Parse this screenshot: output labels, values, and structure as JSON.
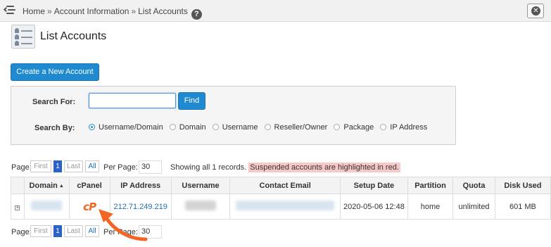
{
  "breadcrumb": {
    "home": "Home",
    "section": "Account Information",
    "current": "List Accounts",
    "separator": "»"
  },
  "page": {
    "title": "List Accounts"
  },
  "actions": {
    "create_label": "Create a New Account"
  },
  "search": {
    "search_for_label": "Search For:",
    "input_value": "",
    "find_label": "Find",
    "search_by_label": "Search By:",
    "options": [
      "Username/Domain",
      "Domain",
      "Username",
      "Reseller/Owner",
      "Package",
      "IP Address"
    ],
    "selected": "Username/Domain"
  },
  "pager": {
    "page_label": "Page:",
    "first": "First",
    "current": "1",
    "last": "Last",
    "all": "All",
    "per_page_label": "Per Page:",
    "per_page_value": "30"
  },
  "status": {
    "showing": "Showing all 1 records.",
    "suspended_note": "Suspended accounts are highlighted in red."
  },
  "table": {
    "columns": [
      "Domain",
      "cPanel",
      "IP Address",
      "Username",
      "Contact Email",
      "Setup Date",
      "Partition",
      "Quota",
      "Disk Used"
    ],
    "rows": [
      {
        "expand": "+",
        "domain": "",
        "cpanel_logo": "cP",
        "ip": "212.71.249.219",
        "username": "",
        "email": "",
        "setup_date": "2020-05-06 12:48",
        "partition": "home",
        "quota": "unlimited",
        "disk_used": "601 MB"
      }
    ]
  },
  "colors": {
    "accent": "#1f8ad0",
    "cpanel_orange": "#f26522",
    "suspended_bg": "#f7c8c8",
    "link": "#1f6fb5"
  },
  "icons": {
    "menu": "menu-collapse-icon",
    "help": "help-icon",
    "close": "close-icon",
    "page": "list-accounts-icon",
    "sort": "sort-asc-icon",
    "expand": "expand-icon",
    "cpanel": "cpanel-logo",
    "annotation": "orange-arrow-icon"
  }
}
